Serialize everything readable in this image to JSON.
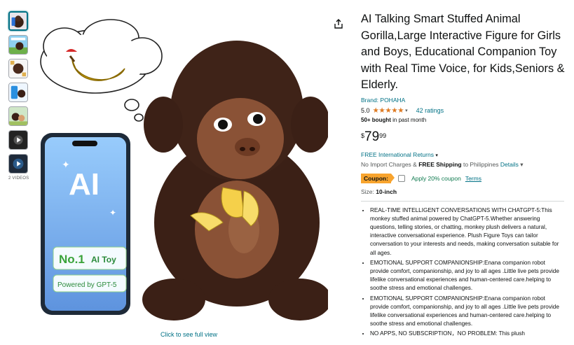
{
  "thumbnails": {
    "videos_label": "2 VIDEOS"
  },
  "main_image": {
    "badge_ai": "AI",
    "badge_no1": "No.1",
    "badge_ai_toy": "AI Toy",
    "badge_powered": "Powered by GPT-5",
    "see_full_view": "Click to see full view"
  },
  "product": {
    "title": "AI Talking Smart Stuffed Animal Gorilla,Large Interactive Figure for Girls and Boys, Educational Companion Toy with Real Time Voice, for Kids,Seniors & Elderly.",
    "brand": "Brand: POHAHA",
    "rating_value": "5.0",
    "stars": "★★★★★",
    "ratings_count": "42 ratings",
    "bought_bold": "50+ bought",
    "bought_rest": " in past month",
    "price_symbol": "$",
    "price_whole": "79",
    "price_fraction": "99",
    "returns": "FREE International Returns",
    "shipping_prefix": "No Import Charges & ",
    "shipping_bold": "FREE Shipping",
    "shipping_mid": " to Philippines ",
    "shipping_details": "Details",
    "coupon_badge": "Coupon:",
    "coupon_text": "Apply 20% coupon",
    "coupon_terms": "Terms",
    "size_label": "Size: ",
    "size_value": "10-inch",
    "bullets": [
      "REAL-TIME INTELLIGENT CONVERSATIONS WITH CHATGPT-5:This monkey stuffed animal powered by ChatGPT-5.Whether answering questions, telling stories, or chatting, monkey plush delivers a natural, interactive conversational experience. Plush Figure Toys can tailor conversation to your interests and needs, making conversation suitable for all ages.",
      "EMOTIONAL SUPPORT COMPANIONSHIP:Enana companion robot provide comfort, companionship, and joy to all ages .Little live pets provide lifelike conversational experiences and human-centered care.helping to soothe stress and emotional challenges.",
      "EMOTIONAL SUPPORT COMPANIONSHIP:Enana companion robot provide comfort, companionship, and joy to all ages .Little live pets provide lifelike conversational experiences and human-centered care.helping to soothe stress and emotional challenges.",
      "NO APPS, NO SUBSCRIPTION，NO PROBLEM:  This plush"
    ]
  },
  "colors": {
    "link": "#007185",
    "star": "#de7921",
    "coupon": "#f8a42e",
    "gorilla_fur": "#3b2016"
  }
}
